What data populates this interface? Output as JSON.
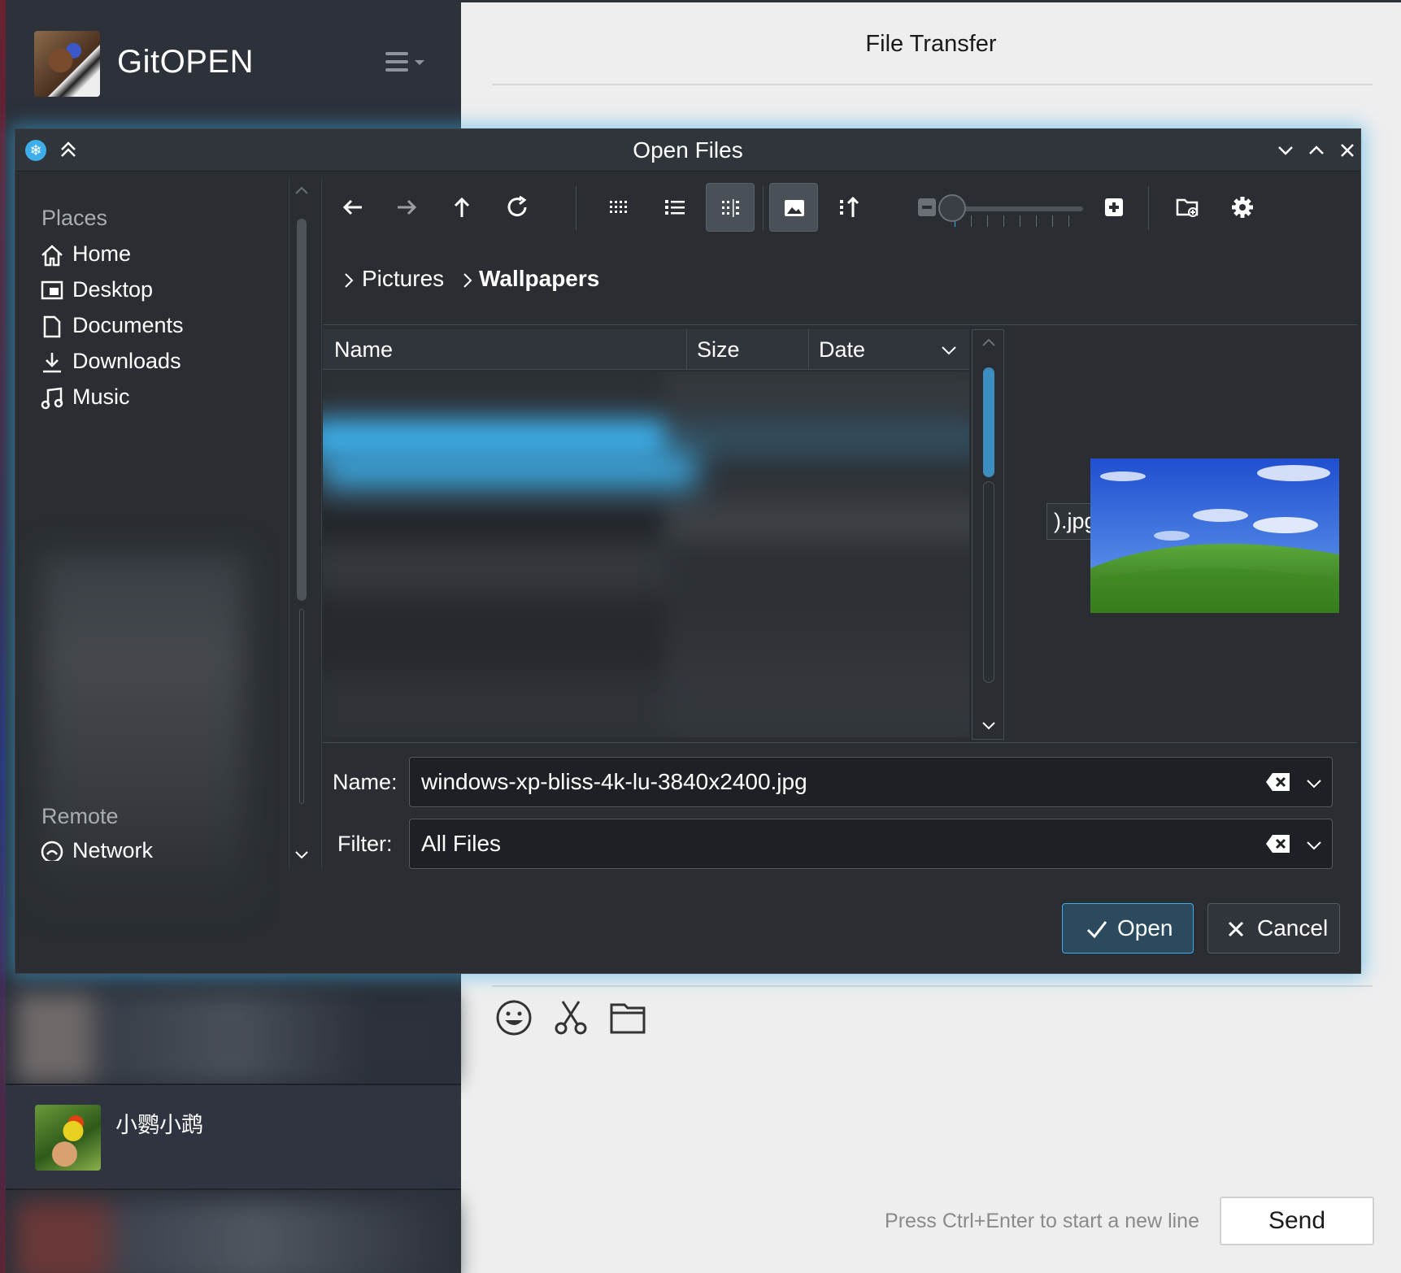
{
  "app": {
    "name": "GitOPEN",
    "conversation_name": "小鹦小鹉"
  },
  "chat": {
    "title": "File Transfer",
    "hint": "Press Ctrl+Enter to start a new line",
    "send_label": "Send"
  },
  "dialog": {
    "title": "Open Files",
    "places": {
      "section_places": "Places",
      "items": [
        {
          "label": "Home",
          "icon": "home-icon"
        },
        {
          "label": "Desktop",
          "icon": "desktop-icon"
        },
        {
          "label": "Documents",
          "icon": "document-icon"
        },
        {
          "label": "Downloads",
          "icon": "download-icon"
        },
        {
          "label": "Music",
          "icon": "music-icon"
        }
      ],
      "section_remote": "Remote",
      "remote_items": [
        {
          "label": "Network",
          "icon": "network-icon"
        }
      ]
    },
    "breadcrumb": [
      "Pictures",
      "Wallpapers"
    ],
    "columns": [
      "Name",
      "Size",
      "Date"
    ],
    "tooltip_text": ").jpg",
    "name_label": "Name:",
    "name_value": "windows-xp-bliss-4k-lu-3840x2400.jpg",
    "filter_label": "Filter:",
    "filter_value": "All Files",
    "open_label": "Open",
    "cancel_label": "Cancel"
  },
  "colors": {
    "accent": "#3daee9",
    "dialog_bg": "#2a2e32",
    "sidebar_bg": "#2c313a",
    "chat_bg": "#eeeeee"
  }
}
